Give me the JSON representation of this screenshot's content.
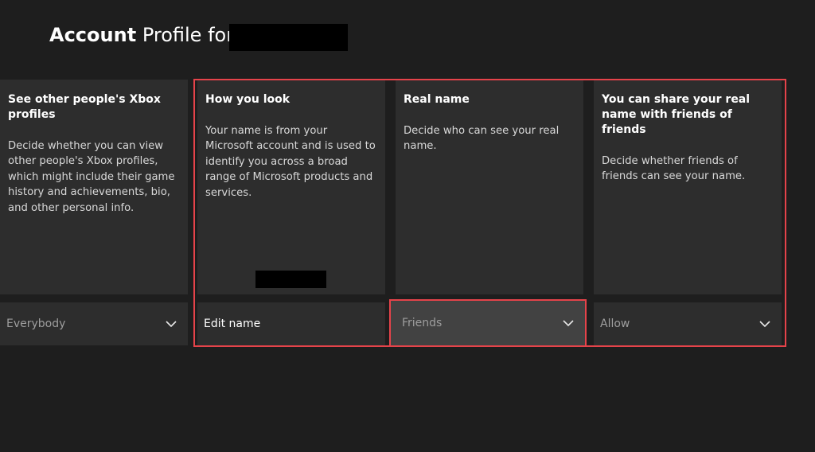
{
  "header": {
    "title_bold": "Account",
    "title_light": "Profile for"
  },
  "cards": [
    {
      "heading": "See other people's Xbox profiles",
      "description": "Decide whether you can view other people's Xbox profiles, which might include their game history and achievements, bio, and other personal info.",
      "control_label": "Everybody",
      "control_icon": "chevron-down-icon"
    },
    {
      "heading": "How you look",
      "description": "Your name is from your Microsoft account and is used to identify you across a broad range of Microsoft products and services.",
      "control_label": "Edit name"
    },
    {
      "heading": "Real name",
      "description": "Decide who can see your real name.",
      "control_label": "Friends",
      "control_icon": "chevron-down-icon"
    },
    {
      "heading": "You can share your real name with friends of friends",
      "description": "Decide whether friends of friends can see your name.",
      "control_label": "Allow",
      "control_icon": "chevron-down-icon"
    }
  ],
  "colors": {
    "background": "#1e1e1e",
    "card": "#2d2d2d",
    "focused_control": "#424242",
    "highlight": "#e5434a"
  }
}
